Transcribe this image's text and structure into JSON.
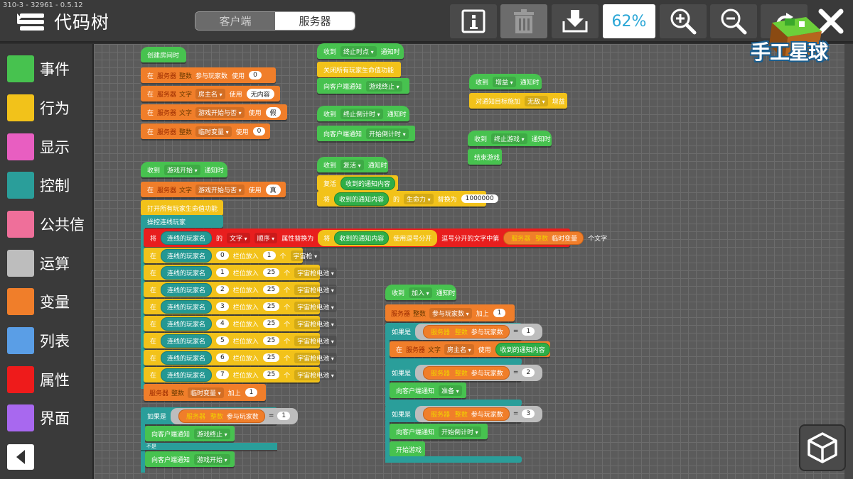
{
  "version": "310-3 - 32961 - 0.5.12",
  "app_title": "代码树",
  "tabs": {
    "client": "客户端",
    "server": "服务器"
  },
  "toolbar": {
    "zoom": "62%"
  },
  "logo_text": "手工星球",
  "categories": [
    {
      "label": "事件",
      "color": "#47c24f"
    },
    {
      "label": "行为",
      "color": "#f2c21a"
    },
    {
      "label": "显示",
      "color": "#e85ec1"
    },
    {
      "label": "控制",
      "color": "#2a9e9a"
    },
    {
      "label": "公共信",
      "color": "#ef6f9a"
    },
    {
      "label": "运算",
      "color": "#bdbdbd"
    },
    {
      "label": "变量",
      "color": "#f07e2a"
    },
    {
      "label": "列表",
      "color": "#5a9ee6"
    },
    {
      "label": "属性",
      "color": "#ee1b1b"
    },
    {
      "label": "界面",
      "color": "#a868ef"
    }
  ],
  "icons": {
    "info": "info-icon",
    "trash": "trash-icon",
    "export": "export-icon",
    "zoomin": "zoom-in-icon",
    "zoomout": "zoom-out-icon",
    "undo": "undo-icon",
    "close": "close-icon",
    "collapse": "collapse-left-icon",
    "view3d": "cube-icon"
  },
  "blocks": {
    "s1": {
      "hat": "创建房间时",
      "r1": {
        "k1": "在",
        "src": "服务器",
        "type": "整数",
        "name": "参与玩家数",
        "k2": "使用",
        "val": "0"
      },
      "r2": {
        "k1": "在",
        "src": "服务器",
        "type": "文字",
        "name": "房主名",
        "k2": "使用",
        "val": "无内容"
      },
      "r3": {
        "k1": "在",
        "src": "服务器",
        "type": "文字",
        "name": "游戏开始与否",
        "k2": "使用",
        "val": "假"
      },
      "r4": {
        "k1": "在",
        "src": "服务器",
        "type": "整数",
        "name": "临时变量",
        "k2": "使用",
        "val": "0"
      }
    },
    "s2": {
      "hat": {
        "pre": "收到",
        "dd": "游戏开始",
        "post": "通知时"
      },
      "r1": {
        "k1": "在",
        "src": "服务器",
        "type": "文字",
        "name": "游戏开始与否",
        "k2": "使用",
        "val": "真"
      },
      "r2": "打开所有玩家生命值功能",
      "r3": "操控连线玩家",
      "prop": {
        "k1": "将",
        "p1": "连线的玩家名",
        "k2": "的",
        "dd1": "文字",
        "dd2": "顺序",
        "k3": "属性替换为",
        "k4": "将",
        "p2": "收到的通知内容",
        "k5": "使用逗号分开",
        "k6": "逗号分开的文字中第",
        "src": "服务器",
        "type": "整数",
        "name": "临时变量",
        "k7": "个文字"
      },
      "slots": [
        {
          "k1": "在",
          "p": "连线的玩家名",
          "n": "0",
          "k2": "栏位放入",
          "q": "1",
          "k3": "个",
          "item": "宇宙枪"
        },
        {
          "k1": "在",
          "p": "连线的玩家名",
          "n": "1",
          "k2": "栏位放入",
          "q": "25",
          "k3": "个",
          "item": "宇宙枪电池"
        },
        {
          "k1": "在",
          "p": "连线的玩家名",
          "n": "2",
          "k2": "栏位放入",
          "q": "25",
          "k3": "个",
          "item": "宇宙枪电池"
        },
        {
          "k1": "在",
          "p": "连线的玩家名",
          "n": "3",
          "k2": "栏位放入",
          "q": "25",
          "k3": "个",
          "item": "宇宙枪电池"
        },
        {
          "k1": "在",
          "p": "连线的玩家名",
          "n": "4",
          "k2": "栏位放入",
          "q": "25",
          "k3": "个",
          "item": "宇宙枪电池"
        },
        {
          "k1": "在",
          "p": "连线的玩家名",
          "n": "5",
          "k2": "栏位放入",
          "q": "25",
          "k3": "个",
          "item": "宇宙枪电池"
        },
        {
          "k1": "在",
          "p": "连线的玩家名",
          "n": "6",
          "k2": "栏位放入",
          "q": "25",
          "k3": "个",
          "item": "宇宙枪电池"
        },
        {
          "k1": "在",
          "p": "连线的玩家名",
          "n": "7",
          "k2": "栏位放入",
          "q": "25",
          "k3": "个",
          "item": "宇宙枪电池"
        }
      ],
      "inc": {
        "src": "服务器",
        "type": "整数",
        "name": "临时变量",
        "k": "加上",
        "val": "1"
      },
      "if": {
        "k": "如果是",
        "src": "服务器",
        "type": "整数",
        "name": "参与玩家数",
        "op": "=",
        "val": "1"
      },
      "send1": {
        "k": "向客户端通知",
        "dd": "游戏终止"
      },
      "else": "不是",
      "send2": {
        "k": "向客户端通知",
        "dd": "游戏开始"
      }
    },
    "s3": {
      "hat": {
        "pre": "收到",
        "dd": "终止时点",
        "post": "通知时"
      },
      "r1": "关闭所有玩家生命值功能",
      "r2": {
        "k": "向客户端通知",
        "dd": "游戏终止"
      }
    },
    "s4": {
      "hat": {
        "pre": "收到",
        "dd": "终止倒计时",
        "post": "通知时"
      },
      "r1": {
        "k": "向客户端通知",
        "dd": "开始倒计时"
      }
    },
    "s5": {
      "hat": {
        "pre": "收到",
        "dd": "复活",
        "post": "通知时"
      },
      "r1": {
        "k": "复活",
        "p": "收到的通知内容"
      },
      "r2": {
        "k1": "将",
        "p": "收到的通知内容",
        "k2": "的",
        "dd": "生命力",
        "k3": "替换为",
        "val": "1000000"
      }
    },
    "s6": {
      "hat": {
        "pre": "收到",
        "dd": "增益",
        "post": "通知时"
      },
      "r1": {
        "k1": "对通知目标施加",
        "dd": "无敌",
        "k2": "增益"
      }
    },
    "s7": {
      "hat": {
        "pre": "收到",
        "dd": "终止游戏",
        "post": "通知时"
      },
      "r1": "结束游戏"
    },
    "s8": {
      "hat": {
        "pre": "收到",
        "dd": "加入",
        "post": "通知时"
      },
      "inc": {
        "src": "服务器",
        "type": "整数",
        "name": "参与玩家数",
        "k": "加上",
        "val": "1"
      },
      "if1": {
        "k": "如果是",
        "src": "服务器",
        "type": "整数",
        "name": "参与玩家数",
        "op": "=",
        "val": "1"
      },
      "set": {
        "k1": "在",
        "src": "服务器",
        "type": "文字",
        "name": "房主名",
        "k2": "使用",
        "p": "收到的通知内容"
      },
      "if2": {
        "k": "如果是",
        "src": "服务器",
        "type": "整数",
        "name": "参与玩家数",
        "op": "=",
        "val": "2"
      },
      "send2": {
        "k": "向客户端通知",
        "dd": "准备"
      },
      "if3": {
        "k": "如果是",
        "src": "服务器",
        "type": "整数",
        "name": "参与玩家数",
        "op": "=",
        "val": "3"
      },
      "send3": {
        "k": "向客户端通知",
        "dd": "开始倒计时"
      },
      "start": "开始游戏"
    }
  }
}
